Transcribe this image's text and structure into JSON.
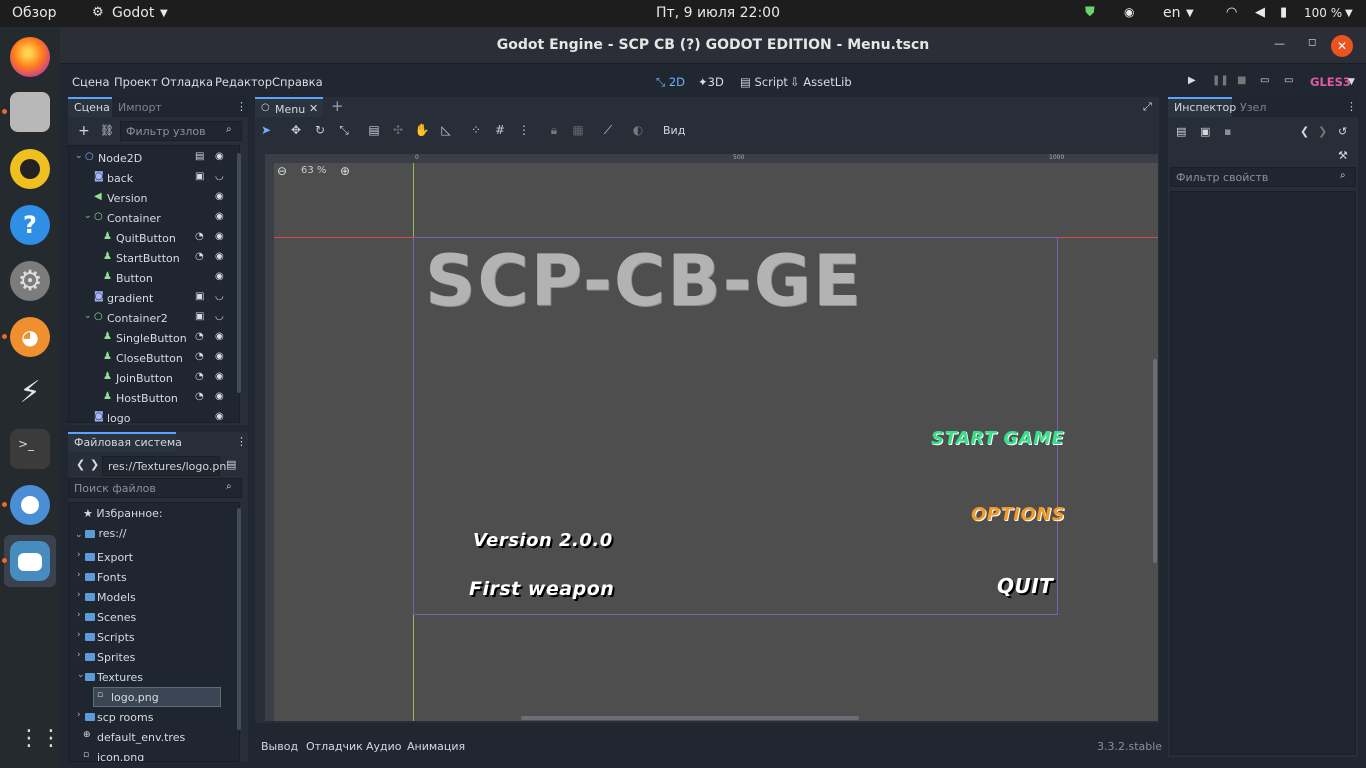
{
  "topbar": {
    "overview": "Обзор",
    "app_name": "Godot",
    "datetime": "Пт, 9 июля  22:00",
    "lang": "en",
    "battery": "100 %"
  },
  "window": {
    "title": "Godot Engine - SCP CB (?) GODOT EDITION - Menu.tscn"
  },
  "menubar": {
    "items": [
      "Сцена",
      "Проект",
      "Отладка",
      "Редактор",
      "Справка"
    ],
    "modes": [
      "2D",
      "3D",
      "Script",
      "AssetLib"
    ],
    "renderer": "GLES3"
  },
  "scene_panel": {
    "tabs": [
      "Сцена",
      "Импорт"
    ],
    "filter_placeholder": "Фильтр узлов",
    "nodes": [
      {
        "name": "Node2D",
        "indent": 0
      },
      {
        "name": "back",
        "indent": 1
      },
      {
        "name": "Version",
        "indent": 1
      },
      {
        "name": "Container",
        "indent": 1
      },
      {
        "name": "QuitButton",
        "indent": 2
      },
      {
        "name": "StartButton",
        "indent": 2
      },
      {
        "name": "Button",
        "indent": 2
      },
      {
        "name": "gradient",
        "indent": 1
      },
      {
        "name": "Container2",
        "indent": 1
      },
      {
        "name": "SingleButton",
        "indent": 2
      },
      {
        "name": "CloseButton",
        "indent": 2
      },
      {
        "name": "JoinButton",
        "indent": 2
      },
      {
        "name": "HostButton",
        "indent": 2
      },
      {
        "name": "logo",
        "indent": 1
      }
    ]
  },
  "filesystem": {
    "title": "Файловая система",
    "path": "res://Textures/logo.pn",
    "search_placeholder": "Поиск файлов",
    "favorites": "Избранное:",
    "root": "res://",
    "items": [
      "Export",
      "Fonts",
      "Models",
      "Scenes",
      "Scripts",
      "Sprites",
      "Textures",
      "logo.png",
      "scp rooms",
      "default_env.tres",
      "icon.png"
    ]
  },
  "editor": {
    "tab_label": "Menu",
    "view_label": "Вид",
    "zoom": "63 %",
    "ruler_ticks": [
      "0",
      "500",
      "1000"
    ]
  },
  "game": {
    "logo": "SCP-CB-GE",
    "start": "START GAME",
    "options": "OPTIONS",
    "quit": "QUIT",
    "version": "Version 2.0.0",
    "subtitle": "First weapon"
  },
  "inspector": {
    "tabs": [
      "Инспектор",
      "Узел"
    ],
    "filter_placeholder": "Фильтр свойств"
  },
  "bottom": {
    "tabs": [
      "Вывод",
      "Отладчик",
      "Аудио",
      "Анимация"
    ],
    "version": "3.3.2.stable"
  },
  "colors": {
    "start": "#36e08a",
    "options": "#f09a2a",
    "quit": "#ffffff"
  }
}
